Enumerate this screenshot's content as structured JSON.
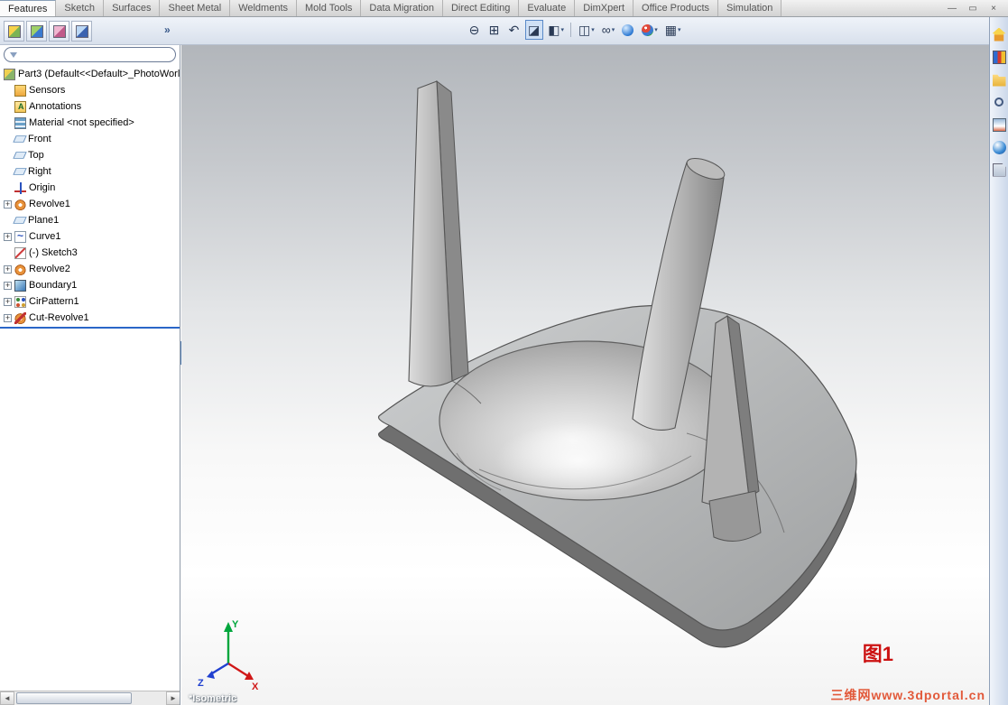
{
  "ribbon": {
    "tabs": [
      {
        "label": "Features",
        "state": "active"
      },
      {
        "label": "Sketch"
      },
      {
        "label": "Surfaces"
      },
      {
        "label": "Sheet Metal"
      },
      {
        "label": "Weldments"
      },
      {
        "label": "Mold Tools"
      },
      {
        "label": "Data Migration"
      },
      {
        "label": "Direct Editing"
      },
      {
        "label": "Evaluate"
      },
      {
        "label": "DimXpert"
      },
      {
        "label": "Office Products"
      },
      {
        "label": "Simulation"
      }
    ]
  },
  "window_controls": {
    "minimize": "—",
    "restore": "▭",
    "close": "×"
  },
  "fm_toolbar": {
    "icons": [
      {
        "icon": "featuremanager-tab-icon"
      },
      {
        "icon": "propertymanager-tab-icon"
      },
      {
        "icon": "configurationmanager-tab-icon"
      },
      {
        "icon": "displaymanager-tab-icon"
      }
    ],
    "overflow": "»"
  },
  "filter": {
    "value": "",
    "placeholder": ""
  },
  "feature_tree": {
    "expander_glyph": "+",
    "root": {
      "label": "Part3  (Default<<Default>_PhotoWorl",
      "icon": "part-icon"
    },
    "items": [
      {
        "label": "Sensors",
        "icon": "sensors-folder-icon",
        "expand": false
      },
      {
        "label": "Annotations",
        "icon": "annotations-folder-icon",
        "expand": false
      },
      {
        "label": "Material <not specified>",
        "icon": "material-icon",
        "expand": false
      },
      {
        "label": "Front",
        "icon": "plane-icon",
        "expand": false
      },
      {
        "label": "Top",
        "icon": "plane-icon",
        "expand": false
      },
      {
        "label": "Right",
        "icon": "plane-icon",
        "expand": false
      },
      {
        "label": "Origin",
        "icon": "origin-icon",
        "expand": false
      },
      {
        "label": "Revolve1",
        "icon": "revolve-icon",
        "expand": true
      },
      {
        "label": "Plane1",
        "icon": "plane-icon",
        "expand": false
      },
      {
        "label": "Curve1",
        "icon": "curve-icon",
        "expand": true
      },
      {
        "label": "(-) Sketch3",
        "icon": "sketch-icon",
        "expand": false
      },
      {
        "label": "Revolve2",
        "icon": "revolve-icon",
        "expand": true
      },
      {
        "label": "Boundary1",
        "icon": "boundary-icon",
        "expand": true
      },
      {
        "label": "CirPattern1",
        "icon": "cirpattern-icon",
        "expand": true
      },
      {
        "label": "Cut-Revolve1",
        "icon": "cutrevolve-icon",
        "expand": true
      }
    ]
  },
  "headsup": {
    "items": [
      {
        "icon": "zoom-to-fit-icon",
        "glyph": "⊖"
      },
      {
        "icon": "zoom-to-area-icon",
        "glyph": "⊞"
      },
      {
        "icon": "previous-view-icon",
        "glyph": "↶"
      },
      {
        "icon": "section-view-icon",
        "glyph": "◪",
        "state": "pressed"
      },
      {
        "icon": "view-orientation-icon",
        "glyph": "◧",
        "dropdown": "▾"
      },
      {
        "icon": "separator-line",
        "state": "sep",
        "glyph": ""
      },
      {
        "icon": "display-style-icon",
        "glyph": "◫",
        "dropdown": "▾"
      },
      {
        "icon": "hide-show-items-icon",
        "glyph": "∞",
        "dropdown": "▾"
      },
      {
        "icon": "apply-scene-icon",
        "glyph": ""
      },
      {
        "icon": "edit-appearance-icon",
        "glyph": "",
        "dropdown": "▾"
      },
      {
        "icon": "view-settings-icon",
        "glyph": "▦",
        "dropdown": "▾"
      }
    ]
  },
  "task_pane": {
    "items": [
      {
        "icon": "solidworks-resources-icon"
      },
      {
        "icon": "design-library-icon"
      },
      {
        "icon": "file-explorer-icon"
      },
      {
        "icon": "search-pane-icon"
      },
      {
        "icon": "view-palette-icon"
      },
      {
        "icon": "appearances-scenes-icon"
      },
      {
        "icon": "custom-properties-icon"
      }
    ]
  },
  "scrollbar": {
    "left_arrow": "◄",
    "right_arrow": "►"
  },
  "splitter": {
    "collapse_arrow": "◄"
  },
  "viewport": {
    "view_label": "*Isometric",
    "figure_label": "图1",
    "watermark": "三维网www.3dportal.cn",
    "triad": {
      "x": "X",
      "y": "Y",
      "z": "Z"
    }
  },
  "colors": {
    "accent": "#2a66c8",
    "figure_label": "#cc1111",
    "watermark": "#e2593a",
    "model_gray": "#b0b0b0"
  }
}
